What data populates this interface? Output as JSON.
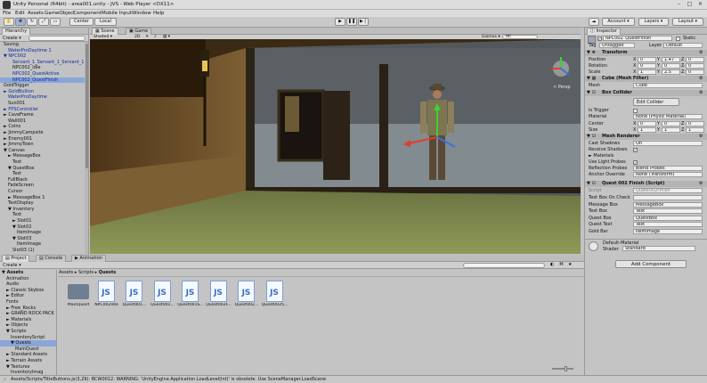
{
  "window": {
    "title": "Unity Personal (64bit) - area001.unity - JVS - Web Player <DX11>"
  },
  "menu": [
    "File",
    "Edit",
    "Assets",
    "GameObject",
    "Component",
    "Mobile Input",
    "Window",
    "Help"
  ],
  "toolbar": {
    "pivot": "Center",
    "space": "Local",
    "account": "Account",
    "layers": "Layers",
    "layout": "Layout"
  },
  "hierarchy": {
    "tab": "Hierarchy",
    "create": "Create",
    "items": [
      {
        "label": "Saving",
        "indent": 0,
        "blue": false
      },
      {
        "label": "WaterProDaytime 1",
        "indent": 1,
        "blue": true
      },
      {
        "label": "▼ NPC002",
        "indent": 0,
        "blue": true
      },
      {
        "label": "Servant_1_Servant_1_Servant_1",
        "indent": 2,
        "blue": true
      },
      {
        "label": "NPC002_Idle",
        "indent": 2,
        "blue": false
      },
      {
        "label": "NPC002_QuestActive",
        "indent": 2,
        "blue": true
      },
      {
        "label": "NPC002_QuestFinish",
        "indent": 2,
        "blue": true,
        "sel": true
      },
      {
        "label": "GoldTrigger",
        "indent": 0,
        "blue": false
      },
      {
        "label": "► GoldBullion",
        "indent": 0,
        "blue": true
      },
      {
        "label": "WaterProDaytime",
        "indent": 1,
        "blue": true
      },
      {
        "label": "Sun001",
        "indent": 1,
        "blue": false
      },
      {
        "label": "► FPSController",
        "indent": 0,
        "blue": true
      },
      {
        "label": "► CaveFrame",
        "indent": 0,
        "blue": false
      },
      {
        "label": "Wall001",
        "indent": 1,
        "blue": false
      },
      {
        "label": "► Coins",
        "indent": 0,
        "blue": false
      },
      {
        "label": "► JimmyCampsite",
        "indent": 0,
        "blue": false
      },
      {
        "label": "► Enemy001",
        "indent": 0,
        "blue": false
      },
      {
        "label": "► JimmyTown",
        "indent": 0,
        "blue": false
      },
      {
        "label": "▼ Canvas",
        "indent": 0,
        "blue": false
      },
      {
        "label": "► MessageBox",
        "indent": 1,
        "blue": false
      },
      {
        "label": "Text",
        "indent": 2,
        "blue": false
      },
      {
        "label": "▼ QuestBox",
        "indent": 1,
        "blue": false
      },
      {
        "label": "Text",
        "indent": 2,
        "blue": false
      },
      {
        "label": "FullBlack",
        "indent": 1,
        "blue": false
      },
      {
        "label": "FadeScreen",
        "indent": 1,
        "blue": false
      },
      {
        "label": "Cursor",
        "indent": 1,
        "blue": false
      },
      {
        "label": "► MessageBox 1",
        "indent": 1,
        "blue": false
      },
      {
        "label": "TextDisplay",
        "indent": 1,
        "blue": false
      },
      {
        "label": "▼ Inventory",
        "indent": 1,
        "blue": false
      },
      {
        "label": "Text",
        "indent": 2,
        "blue": false
      },
      {
        "label": "► Slot01",
        "indent": 2,
        "blue": false
      },
      {
        "label": "▼ Slot02",
        "indent": 2,
        "blue": false
      },
      {
        "label": "ItemImage",
        "indent": 3,
        "blue": false
      },
      {
        "label": "▼ Slot03",
        "indent": 2,
        "blue": false
      },
      {
        "label": "ItemImage",
        "indent": 3,
        "blue": false
      },
      {
        "label": "Slot03 (1)",
        "indent": 2,
        "blue": false
      }
    ]
  },
  "scene": {
    "tab_scene": "Scene",
    "tab_game": "Game",
    "shading": "Shaded",
    "gizmos": "Gizmos",
    "search": "All",
    "persp": "< Persp"
  },
  "project": {
    "tab_project": "Project",
    "tab_console": "Console",
    "tab_animation": "Animation",
    "create": "Create",
    "breadcrumb": [
      "Assets",
      "Scripts",
      "Quests"
    ],
    "tree": [
      {
        "label": "▼ Assets",
        "indent": 0,
        "bold": true
      },
      {
        "label": "Animation",
        "indent": 1
      },
      {
        "label": "Audio",
        "indent": 1
      },
      {
        "label": "► Classic Skybox",
        "indent": 1
      },
      {
        "label": "► Editor",
        "indent": 1
      },
      {
        "label": "Fonts",
        "indent": 1
      },
      {
        "label": "► Free_Rocks",
        "indent": 1
      },
      {
        "label": "► GRAND ROCK PACK",
        "indent": 1
      },
      {
        "label": "► Materials",
        "indent": 1
      },
      {
        "label": "► Objects",
        "indent": 1
      },
      {
        "label": "▼ Scripts",
        "indent": 1
      },
      {
        "label": "InventoryScript",
        "indent": 2
      },
      {
        "label": "▼ Quests",
        "indent": 2,
        "sel": true
      },
      {
        "label": "MainQuest",
        "indent": 3
      },
      {
        "label": "► Standard Assets",
        "indent": 1
      },
      {
        "label": "► Terrain Assets",
        "indent": 1
      },
      {
        "label": "▼ Textures",
        "indent": 1
      },
      {
        "label": "InventoryImag",
        "indent": 2
      }
    ],
    "assets": [
      {
        "label": "MainQuest",
        "type": "folder"
      },
      {
        "label": "NPC002Idle",
        "type": "js"
      },
      {
        "label": "Quest001...",
        "type": "js"
      },
      {
        "label": "Quest001...",
        "type": "js"
      },
      {
        "label": "Quest001S...",
        "type": "js"
      },
      {
        "label": "Quest002F...",
        "type": "js"
      },
      {
        "label": "Quest002...",
        "type": "js"
      },
      {
        "label": "Quest0025...",
        "type": "js"
      }
    ]
  },
  "inspector": {
    "tab": "Inspector",
    "object_name": "NPC002_QuestFinish",
    "static": "Static",
    "tag_label": "Tag",
    "tag": "Untagged",
    "layer_label": "Layer",
    "layer": "Default",
    "transform": {
      "title": "Transform",
      "position": {
        "label": "Position",
        "x": "0",
        "y": "1.47",
        "z": "0"
      },
      "rotation": {
        "label": "Rotation",
        "x": "0",
        "y": "0",
        "z": "0"
      },
      "scale": {
        "label": "Scale",
        "x": "1",
        "y": "2.5",
        "z": "0"
      }
    },
    "mesh_filter": {
      "title": "Cube (Mesh Filter)",
      "mesh_label": "Mesh",
      "mesh": "Cube"
    },
    "box_collider": {
      "title": "Box Collider",
      "edit": "Edit Collider",
      "is_trigger": "Is Trigger",
      "material_label": "Material",
      "material": "None (Physic Material)",
      "center": {
        "label": "Center",
        "x": "0",
        "y": "0",
        "z": "0"
      },
      "size": {
        "label": "Size",
        "x": "1",
        "y": "1",
        "z": "1"
      }
    },
    "mesh_renderer": {
      "title": "Mesh Renderer",
      "cast_shadows": "Cast Shadows",
      "cast_shadows_val": "On",
      "receive_shadows": "Receive Shadows",
      "materials": "► Materials",
      "use_light_probes": "Use Light Probes",
      "reflection_probes": "Reflection Probes",
      "reflection_probes_val": "Blend Probes",
      "anchor_override": "Anchor Override",
      "anchor_override_val": "None (Transform)"
    },
    "script": {
      "title": "Quest 002 Finish (Script)",
      "script_label": "Script",
      "script": "Quest002Finish",
      "fields": [
        {
          "label": "Text Box On Check",
          "value": ""
        },
        {
          "label": "Message Box",
          "value": "MessageBox"
        },
        {
          "label": "Text Box",
          "value": "Text"
        },
        {
          "label": "Quest Box",
          "value": "QuestBox"
        },
        {
          "label": "Quest Text",
          "value": "Text"
        },
        {
          "label": "Gold Bar",
          "value": "ItemImage"
        }
      ]
    },
    "material": {
      "name": "Default-Material",
      "shader_label": "Shader",
      "shader": "Standard"
    },
    "add_component": "Add Component"
  },
  "status": "Assets/Scripts/TitleButtons.js(3,29): BCW0012: WARNING: 'UnityEngine.Application.LoadLevel(int)' is obsolete. Use SceneManager.LoadScene"
}
